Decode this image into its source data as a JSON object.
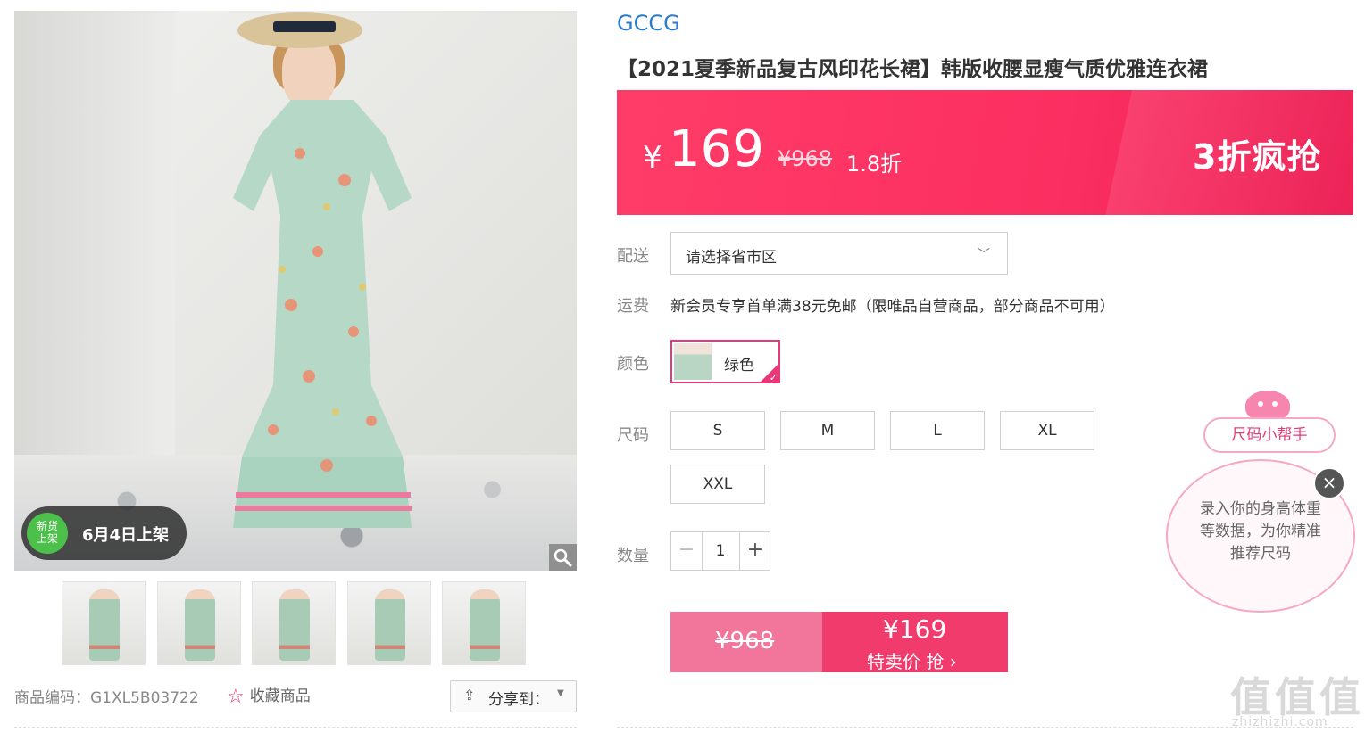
{
  "gallery": {
    "badge": {
      "circle_line1": "新货",
      "circle_line2": "上架",
      "date": "6月4日上架"
    },
    "zoom_icon": "magnifier-icon",
    "thumbnails": [
      {
        "alt": "thumbnail-1"
      },
      {
        "alt": "thumbnail-2"
      },
      {
        "alt": "thumbnail-3"
      },
      {
        "alt": "thumbnail-4"
      },
      {
        "alt": "thumbnail-5"
      }
    ]
  },
  "footer": {
    "sku": "商品编码：G1XL5B03722",
    "favorite_label": "收藏商品",
    "share_label": "分享到："
  },
  "product": {
    "brand": "GCCG",
    "title": "【2021夏季新品复古风印花长裙】韩版收腰显瘦气质优雅连衣裙"
  },
  "price_bar": {
    "currency": "¥",
    "price": "169",
    "original": "¥968",
    "discount": "1.8折",
    "promo": "3折疯抢",
    "colors": {
      "start": "#ff3c68",
      "end": "#ec1e54"
    }
  },
  "options": {
    "shipping_label": "配送",
    "shipping_value": "请选择省市区",
    "freight_label": "运费",
    "freight_text": "新会员专享首单满38元免邮（限唯品自营商品，部分商品不可用）",
    "color_label": "颜色",
    "color_value": "绿色",
    "size_label": "尺码",
    "sizes": [
      "S",
      "M",
      "L",
      "XL",
      "XXL"
    ],
    "qty_label": "数量",
    "qty_value": "1",
    "qty_minus": "−",
    "qty_plus": "+"
  },
  "buy": {
    "original": "¥968",
    "price": "¥169",
    "label": "特卖价 抢 ›"
  },
  "size_helper": {
    "pill": "尺码小帮手",
    "bubble_text": "录入你的身高体重等数据，为你精准推荐尺码",
    "close": "×"
  },
  "watermark": {
    "big": "值值值",
    "small": "zhizhizhi.com"
  }
}
